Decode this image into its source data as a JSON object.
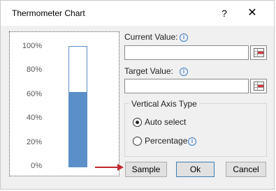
{
  "dialog": {
    "title": "Thermometer Chart",
    "help": "?",
    "close": "✕"
  },
  "preview": {
    "y_ticks": [
      "100%",
      "80%",
      "60%",
      "40%",
      "20%",
      "0%"
    ],
    "fill_fraction": 0.62,
    "fill_color": "#5b8fc9"
  },
  "form": {
    "current_label": "Current Value:",
    "current_value": "",
    "target_label": "Target Value:",
    "target_value": "",
    "info_glyph": "i",
    "axis_group_title": "Vertical Axis Type",
    "option_auto": "Auto select",
    "option_percentage": "Percentage",
    "selected_option": "Auto select"
  },
  "buttons": {
    "sample": "Sample",
    "ok": "Ok",
    "cancel": "Cancel"
  },
  "colors": {
    "accent": "#5b8fc9",
    "arrow": "#c0282d"
  }
}
